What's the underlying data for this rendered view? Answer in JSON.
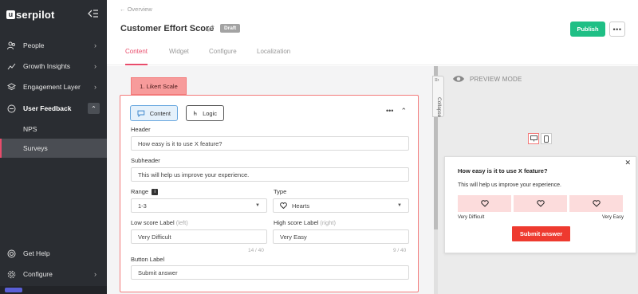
{
  "sidebar": {
    "logo": "serpilot",
    "items": [
      {
        "label": "People",
        "icon": "people-icon"
      },
      {
        "label": "Growth Insights",
        "icon": "growth-icon"
      },
      {
        "label": "Engagement Layer",
        "icon": "layers-icon"
      },
      {
        "label": "User Feedback",
        "icon": "feedback-icon"
      }
    ],
    "subitems": [
      {
        "label": "NPS",
        "active": false
      },
      {
        "label": "Surveys",
        "active": true
      }
    ],
    "bottom": [
      {
        "label": "Get Help",
        "icon": "help-icon"
      },
      {
        "label": "Configure",
        "icon": "gear-icon"
      }
    ]
  },
  "header": {
    "breadcrumb": "Overview",
    "title": "Customer Effort Score",
    "badge": "Draft",
    "publish_label": "Publish",
    "more_label": "•••",
    "tabs": [
      {
        "label": "Content",
        "active": true
      },
      {
        "label": "Widget",
        "active": false
      },
      {
        "label": "Configure",
        "active": false
      },
      {
        "label": "Localization",
        "active": false
      }
    ]
  },
  "editor": {
    "step_label": "1. Likert Scale",
    "content_btn": "Content",
    "logic_btn": "Logic",
    "header_label": "Header",
    "header_value": "How easy is it to use X feature?",
    "subheader_label": "Subheader",
    "subheader_value": "This will help us improve your experience.",
    "range_label": "Range",
    "range_value": "1-3",
    "type_label": "Type",
    "type_value": "Hearts",
    "low_label": "Low score Label",
    "low_hint": "(left)",
    "low_value": "Very Difficult",
    "low_counter": "14 / 40",
    "high_label": "High score Label",
    "high_hint": "(right)",
    "high_value": "Very Easy",
    "high_counter": "9 / 40",
    "button_label": "Button Label",
    "button_value": "Submit answer"
  },
  "preview": {
    "collapse_label": "Collapse",
    "mode_label": "PREVIEW MODE",
    "survey": {
      "question": "How easy is it to use X feature?",
      "subheader": "This will help us improve your experience.",
      "low_label": "Very Difficult",
      "high_label": "Very Easy",
      "submit": "Submit answer"
    }
  },
  "colors": {
    "accent": "#e84c6b",
    "publish": "#1fbf85",
    "submit": "#ee3a2f",
    "sidebar_bg": "#2a2d32"
  }
}
